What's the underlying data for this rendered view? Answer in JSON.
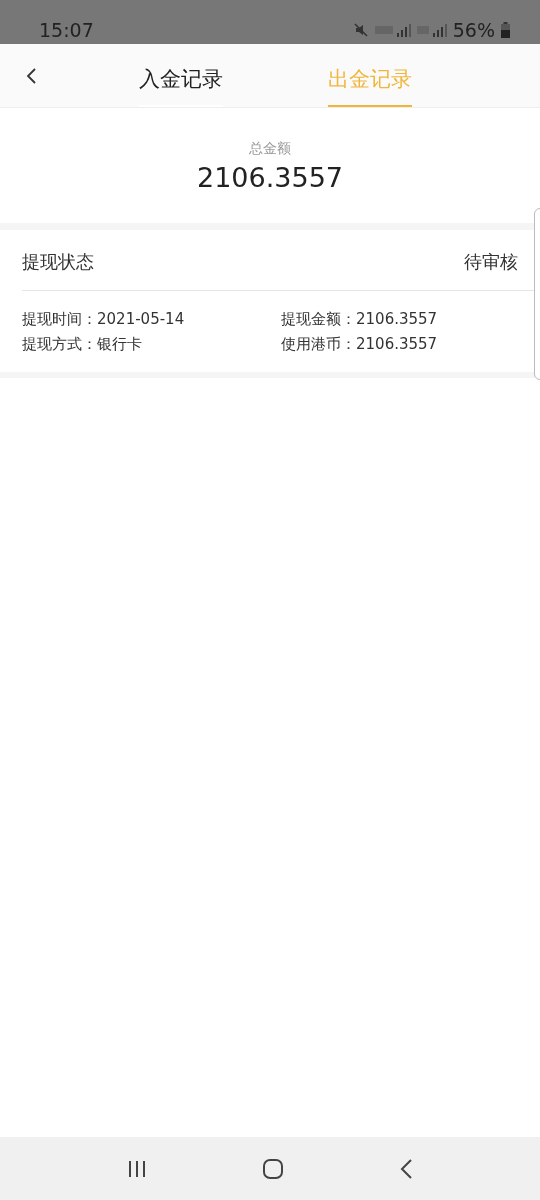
{
  "status_bar": {
    "time": "15:07",
    "battery_text": "56%"
  },
  "tabs": [
    {
      "label": "入金记录",
      "selected": false
    },
    {
      "label": "出金记录",
      "selected": true
    }
  ],
  "summary": {
    "label": "总金额",
    "amount": "2106.3557"
  },
  "records": [
    {
      "status_label": "提现状态",
      "status": "待审核",
      "fields": [
        "提现时间：2021-05-14",
        "提现金额：2106.3557",
        "提现方式：银行卡",
        "使用港币：2106.3557"
      ]
    }
  ]
}
